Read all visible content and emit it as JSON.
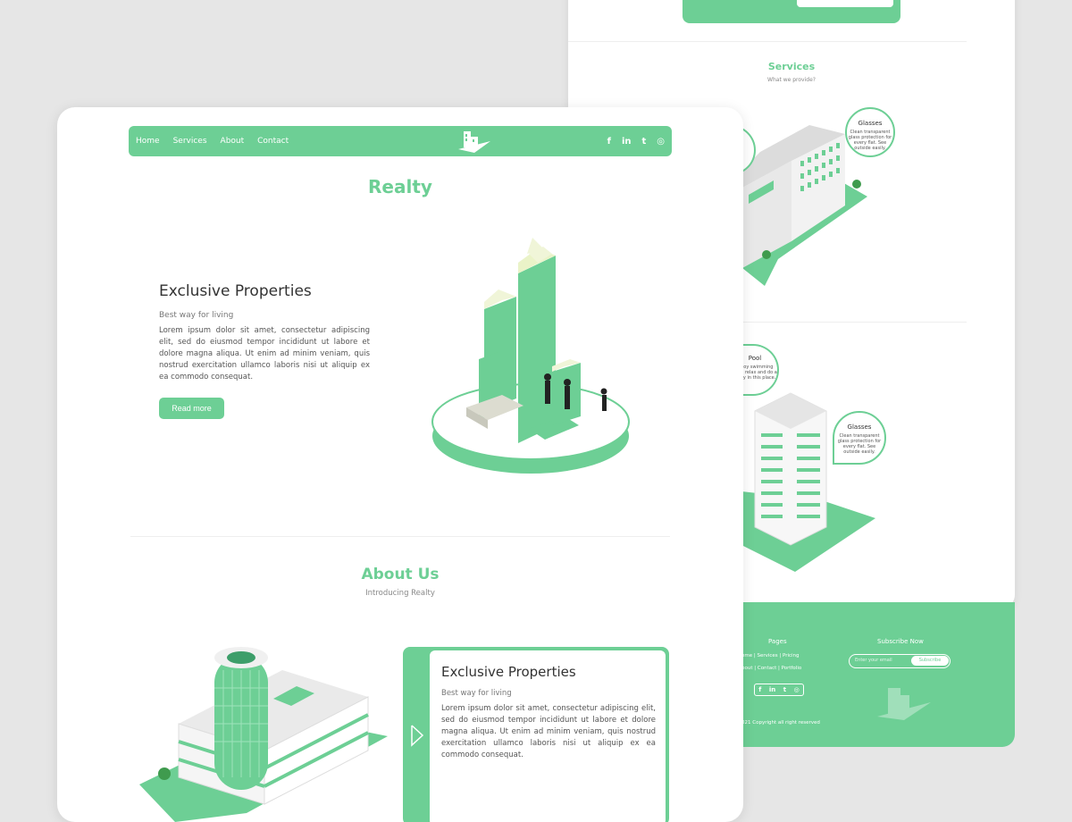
{
  "back": {
    "services_title": "Services",
    "services_sub": "What we provide?",
    "bubble1_title": "Glasses",
    "bubble1_text": "Clean transparent glass protection for every flat. See outside easily.",
    "bubble2_title": "Pool",
    "bubble2_text": "Enjoy swimming pool, relax and do a party in this place.",
    "bubble3_title": "Glasses",
    "bubble3_text": "Clean transparent glass protection for every flat. See outside easily.",
    "footer": {
      "pages": "Pages",
      "subscribe": "Subscribe Now",
      "links1": "ome | Services | Pricing",
      "links2": "bout | Contact | Portfolio",
      "email_placeholder": "Enter your email",
      "subscribe_btn": "Subscribe",
      "copyright": "021 Copyright all right reserved"
    }
  },
  "nav": {
    "home": "Home",
    "services": "Services",
    "about": "About",
    "contact": "Contact"
  },
  "social": {
    "facebook": "f",
    "linkedin": "in",
    "twitter": "t",
    "instagram": "◎"
  },
  "brand": "Realty",
  "hero": {
    "heading": "Exclusive Properties",
    "sub": "Best way for living",
    "text": "Lorem ipsum dolor sit amet, consectetur adipiscing elit, sed do eiusmod tempor incididunt ut labore et dolore magna aliqua. Ut enim ad minim veniam, quis nostrud exercitation ullamco laboris nisi ut aliquip ex ea commodo consequat.",
    "button": "Read more"
  },
  "about": {
    "title": "About Us",
    "sub": "Introducing Realty"
  },
  "card": {
    "heading": "Exclusive Properties",
    "sub": "Best way for living",
    "text": "Lorem ipsum dolor sit amet, consectetur adipiscing elit, sed do eiusmod tempor incididunt ut labore et dolore magna aliqua. Ut enim ad minim veniam, quis nostrud exercitation ullamco laboris nisi ut aliquip ex ea commodo consequat."
  },
  "colors": {
    "accent": "#6dcf95"
  }
}
